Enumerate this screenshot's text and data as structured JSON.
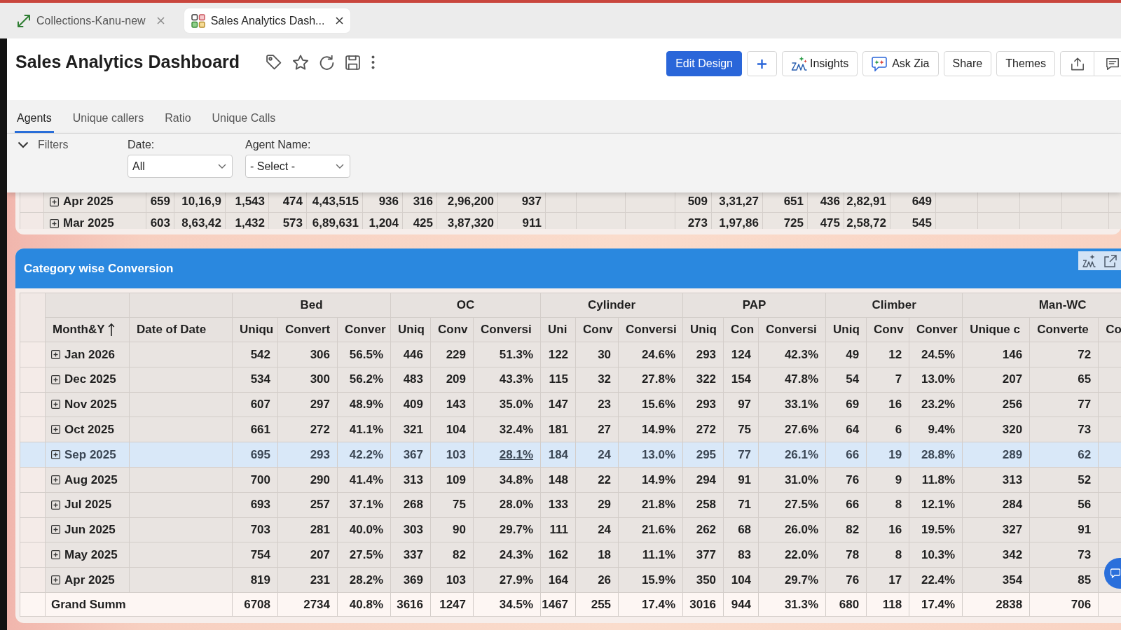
{
  "browser_tabs": [
    {
      "title": "Collections-Kanu-new",
      "kind": "link",
      "selected": false
    },
    {
      "title": "Sales Analytics Dash...",
      "kind": "dashboard",
      "selected": true
    }
  ],
  "header": {
    "title": "Sales Analytics Dashboard",
    "actions": [
      {
        "kind": "primary",
        "label": "Edit Design"
      },
      {
        "kind": "add"
      },
      {
        "kind": "insights",
        "label": "Insights"
      },
      {
        "kind": "zia",
        "label": "Ask Zia"
      },
      {
        "kind": "plain",
        "label": "Share"
      },
      {
        "kind": "plain",
        "label": "Themes"
      },
      {
        "kind": "export"
      },
      {
        "kind": "comments"
      }
    ]
  },
  "view_tabs": [
    {
      "label": "Agents",
      "selected": true
    },
    {
      "label": "Unique callers",
      "selected": false
    },
    {
      "label": "Ratio",
      "selected": false
    },
    {
      "label": "Unique Calls",
      "selected": false
    }
  ],
  "filters": {
    "label": "Filters",
    "expanded": true,
    "fields": [
      {
        "label": "Date:",
        "value": "All"
      },
      {
        "label": "Agent Name:",
        "value": "- Select -"
      }
    ]
  },
  "agents_table": {
    "rows": [
      {
        "label": "Apr 2025",
        "segments": [
          [
            "659",
            "10,16,9",
            "1,543",
            "474",
            "4,43,515",
            "936",
            "316",
            "2,96,200",
            "937"
          ],
          [
            "509",
            "3,31,27",
            "651",
            "436",
            "2,82,91",
            "649"
          ]
        ]
      },
      {
        "label": "Mar 2025",
        "segments": [
          [
            "603",
            "8,63,42",
            "1,432",
            "573",
            "6,89,631",
            "1,204",
            "425",
            "3,87,320",
            "911"
          ],
          [
            "273",
            "1,97,86",
            "725",
            "475",
            "2,58,72",
            "545"
          ]
        ]
      }
    ]
  },
  "category_table": {
    "title": "Category wise Conversion",
    "lead_columns": [
      {
        "label": "Month&Y",
        "sorted": true
      },
      {
        "label": "Date of Date",
        "sorted": false
      }
    ],
    "groups": [
      {
        "label": "Bed",
        "columns": [
          "Uniqu",
          "Convert",
          "Conver"
        ]
      },
      {
        "label": "OC",
        "columns": [
          "Uniq",
          "Conv",
          "Conversi"
        ]
      },
      {
        "label": "Cylinder",
        "columns": [
          "Uni",
          "Conv",
          "Conversi"
        ]
      },
      {
        "label": "PAP",
        "columns": [
          "Uniq",
          "Con",
          "Conversi"
        ]
      },
      {
        "label": "Climber",
        "columns": [
          "Uniq",
          "Conv",
          "Conver"
        ]
      },
      {
        "label": "Man-WC",
        "columns": [
          "Unique c",
          "Converte",
          "Co"
        ]
      }
    ],
    "rows": [
      {
        "label": "Jan 2026",
        "selected": false,
        "cells": [
          "542",
          "306",
          "56.5%",
          "446",
          "229",
          "51.3%",
          "122",
          "30",
          "24.6%",
          "293",
          "124",
          "42.3%",
          "49",
          "12",
          "24.5%",
          "146",
          "72"
        ]
      },
      {
        "label": "Dec 2025",
        "selected": false,
        "cells": [
          "534",
          "300",
          "56.2%",
          "483",
          "209",
          "43.3%",
          "115",
          "32",
          "27.8%",
          "322",
          "154",
          "47.8%",
          "54",
          "7",
          "13.0%",
          "207",
          "65"
        ]
      },
      {
        "label": "Nov 2025",
        "selected": false,
        "cells": [
          "607",
          "297",
          "48.9%",
          "409",
          "143",
          "35.0%",
          "147",
          "23",
          "15.6%",
          "293",
          "97",
          "33.1%",
          "69",
          "16",
          "23.2%",
          "256",
          "77"
        ]
      },
      {
        "label": "Oct 2025",
        "selected": false,
        "cells": [
          "661",
          "272",
          "41.1%",
          "321",
          "104",
          "32.4%",
          "181",
          "27",
          "14.9%",
          "272",
          "75",
          "27.6%",
          "64",
          "6",
          "9.4%",
          "320",
          "73"
        ]
      },
      {
        "label": "Sep 2025",
        "selected": true,
        "cells": [
          "695",
          "293",
          "42.2%",
          "367",
          "103",
          {
            "text": "28.1%",
            "underlined": true
          },
          "184",
          "24",
          "13.0%",
          "295",
          "77",
          "26.1%",
          "66",
          "19",
          "28.8%",
          "289",
          "62"
        ]
      },
      {
        "label": "Aug 2025",
        "selected": false,
        "cells": [
          "700",
          "290",
          "41.4%",
          "313",
          "109",
          "34.8%",
          "148",
          "22",
          "14.9%",
          "294",
          "91",
          "31.0%",
          "76",
          "9",
          "11.8%",
          "313",
          "52"
        ]
      },
      {
        "label": "Jul 2025",
        "selected": false,
        "cells": [
          "693",
          "257",
          "37.1%",
          "268",
          "75",
          "28.0%",
          "133",
          "29",
          "21.8%",
          "258",
          "71",
          "27.5%",
          "66",
          "8",
          "12.1%",
          "284",
          "56"
        ]
      },
      {
        "label": "Jun 2025",
        "selected": false,
        "cells": [
          "703",
          "281",
          "40.0%",
          "303",
          "90",
          "29.7%",
          "111",
          "24",
          "21.6%",
          "262",
          "68",
          "26.0%",
          "82",
          "16",
          "19.5%",
          "327",
          "91"
        ]
      },
      {
        "label": "May 2025",
        "selected": false,
        "cells": [
          "754",
          "207",
          "27.5%",
          "337",
          "82",
          "24.3%",
          "162",
          "18",
          "11.1%",
          "377",
          "83",
          "22.0%",
          "78",
          "8",
          "10.3%",
          "342",
          "73"
        ]
      },
      {
        "label": "Apr 2025",
        "selected": false,
        "cells": [
          "819",
          "231",
          "28.2%",
          "369",
          "103",
          "27.9%",
          "164",
          "26",
          "15.9%",
          "350",
          "104",
          "29.7%",
          "76",
          "17",
          "22.4%",
          "354",
          "85"
        ]
      }
    ],
    "total": {
      "label": "Grand Summ",
      "cells": [
        "6708",
        "2734",
        "40.8%",
        "3616",
        "1247",
        "34.5%",
        "1467",
        "255",
        "17.4%",
        "3016",
        "944",
        "31.3%",
        "680",
        "118",
        "17.4%",
        "2838",
        "706"
      ]
    }
  }
}
